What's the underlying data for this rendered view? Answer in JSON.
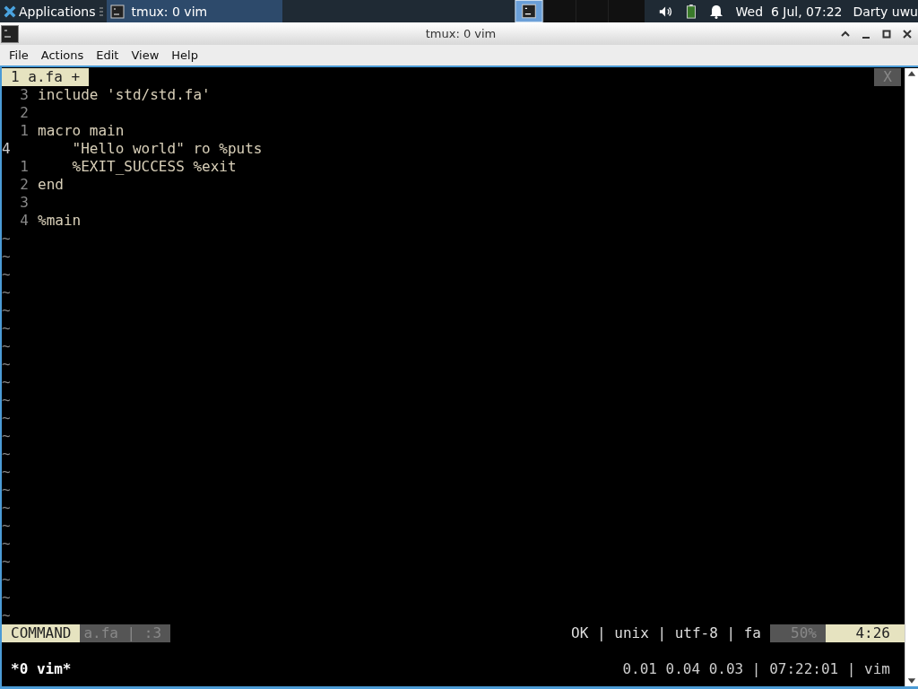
{
  "taskbar": {
    "app_menu": "Applications",
    "tasks": [
      {
        "label": "tmux: 0 vim",
        "selected": true
      }
    ],
    "clock": "Wed  6 Jul, 07:22",
    "user": "Darty uwu"
  },
  "window": {
    "title": "tmux: 0 vim"
  },
  "menu": [
    "File",
    "Actions",
    "Edit",
    "View",
    "Help"
  ],
  "vim": {
    "tab": "1 a.fa +",
    "tab_close": "X",
    "lines": [
      {
        "number": "3",
        "text": "include 'std/std.fa'",
        "current": false
      },
      {
        "number": "2",
        "current": false
      },
      {
        "number": "1",
        "text": "macro main",
        "current": false
      },
      {
        "number": "4",
        "text": "    \"Hello world\" ro %puts",
        "current": true
      },
      {
        "number": "1",
        "text": "    %EXIT_SUCCESS %exit",
        "current": false
      },
      {
        "number": "2",
        "text": "end",
        "current": false
      },
      {
        "number": "3",
        "current": false
      },
      {
        "number": "4",
        "text": "%main",
        "current": false
      }
    ],
    "empty_lines": [
      "~",
      "~",
      "~",
      "~",
      "~",
      "~",
      "~",
      "~",
      "~",
      "~",
      "~",
      "~",
      "~",
      "~",
      "~",
      "~",
      "~",
      "~",
      "~",
      "~",
      "~",
      "~"
    ],
    "statusline": {
      "mode": "COMMAND",
      "file": "a.fa | :3",
      "info": "OK | unix | utf-8 | fa",
      "percent": "50%",
      "position": "4:26"
    }
  },
  "tmux": {
    "window": "*0 vim*",
    "status": "0.01 0.04 0.03 | 07:22:01 | vim"
  }
}
